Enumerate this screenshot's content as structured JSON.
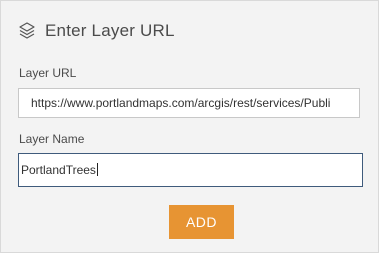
{
  "header": {
    "icon": "layers-icon",
    "title": "Enter Layer URL"
  },
  "layer_url": {
    "label": "Layer URL",
    "value": "https://www.portlandmaps.com/arcgis/rest/services/Publi"
  },
  "layer_name": {
    "label": "Layer Name",
    "value": "PortlandTrees"
  },
  "actions": {
    "add_label": "ADD",
    "add_color": "#e79433"
  }
}
